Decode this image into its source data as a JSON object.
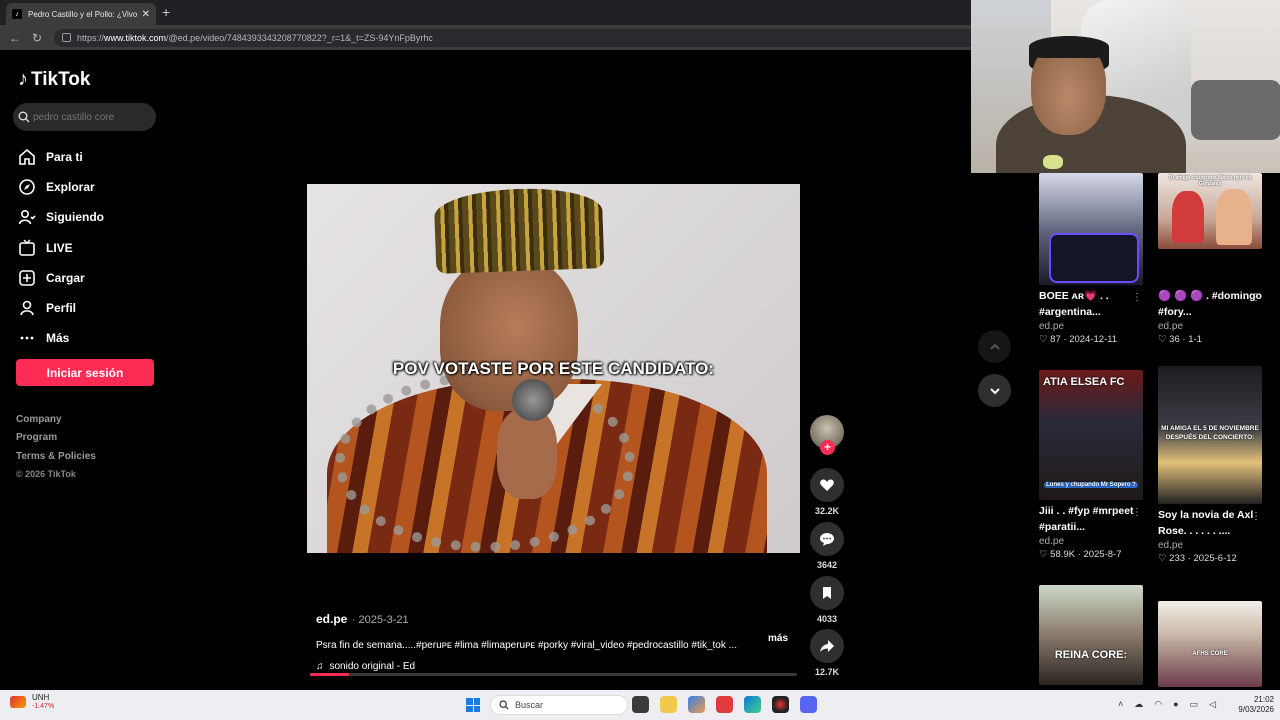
{
  "browser": {
    "tab_title": "Pedro Castillo y el Pollo: ¿Vivo o M",
    "url_prefix": "https://",
    "url_domain": "www.tiktok.com",
    "url_path": "/@ed.pe/video/7484393343208770822?_r=1&_t=ZS-94YnFpByrhc"
  },
  "sidebar": {
    "logo": "TikTok",
    "search_placeholder": "pedro castillo core",
    "nav": [
      {
        "label": "Para ti",
        "icon": "home-icon"
      },
      {
        "label": "Explorar",
        "icon": "compass-icon"
      },
      {
        "label": "Siguiendo",
        "icon": "following-icon"
      },
      {
        "label": "LIVE",
        "icon": "live-icon"
      },
      {
        "label": "Cargar",
        "icon": "upload-icon"
      },
      {
        "label": "Perfil",
        "icon": "profile-icon"
      },
      {
        "label": "Más",
        "icon": "more-icon"
      }
    ],
    "login_label": "Iniciar sesión",
    "footer": [
      "Company",
      "Program",
      "Terms & Policies"
    ],
    "copyright": "© 2026 TikTok"
  },
  "video": {
    "caption": "POV VOTASTE POR ESTE CANDIDATO:",
    "progress": 0.08
  },
  "actions": {
    "likes": "32.2K",
    "comments": "3642",
    "saves": "4033",
    "shares": "12.7K"
  },
  "post": {
    "author": "ed.pe",
    "date": "· 2025-3-21",
    "description": "Psra fin de semana.....#peruᴘᴇ #lima #limaperuᴘᴇ #porky  #viral_video  #pedrocastillo #tik_tok  ...",
    "more": "más",
    "sound": "sonido original - Ed"
  },
  "recommendations": [
    {
      "title": "BOEE ᴀʀ💗 . . #argentina...",
      "author": "ed.pe",
      "likes": "87",
      "date": "2024-12-11"
    },
    {
      "title": "🟣 🟣 🟣 . #domingo #fory...",
      "author": "ed.pe",
      "likes": "36",
      "date": "1-1",
      "thumb_text": "Tu amiga chupetona Mateo pero es Gonzales"
    },
    {
      "title": "Jiii . . #fyp #mrpeet #paratii...",
      "author": "ed.pe",
      "likes": "58.9K",
      "date": "2025-8-7",
      "thumb_text": "ATIA ELSEA FC",
      "thumb_sub": "Lunes y chupando Mr Sopero ?"
    },
    {
      "title": "Soy la novia de Axl Rose. . . . . . ....",
      "author": "ed.pe",
      "likes": "233",
      "date": "2025-6-12",
      "thumb_text": "MI AMIGA EL 5 DE NOVIEMBRE DESPUÉS DEL CONCIERTO:"
    },
    {
      "title": "",
      "author": "",
      "likes": "",
      "date": "",
      "thumb_text": "REINA CORE:"
    },
    {
      "title": "",
      "author": "",
      "likes": "",
      "date": "",
      "thumb_text": "AFHS CORE"
    }
  ],
  "taskbar": {
    "weather_symbol": "UNH",
    "weather_change": "-1.47%",
    "search_placeholder": "Buscar",
    "time": "21:02",
    "date": "9/03/2026"
  },
  "colors": {
    "accent": "#fe2c55",
    "background": "#000000"
  }
}
